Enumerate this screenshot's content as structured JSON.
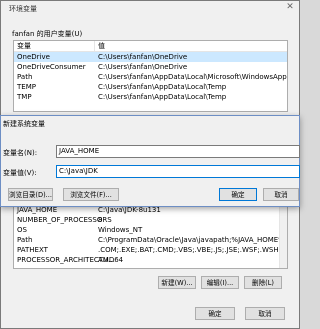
{
  "env_window": {
    "title": "环境变量",
    "close_glyph": "✕",
    "user_vars_label": "fanfan 的用户变量(U)",
    "user_table": {
      "col_var": "变量",
      "col_val": "值",
      "rows": [
        {
          "name": "OneDrive",
          "value": "C:\\Users\\fanfan\\OneDrive"
        },
        {
          "name": "OneDriveConsumer",
          "value": "C:\\Users\\fanfan\\OneDrive"
        },
        {
          "name": "Path",
          "value": "C:\\Users\\fanfan\\AppData\\Local\\Microsoft\\WindowsApps;"
        },
        {
          "name": "TEMP",
          "value": "C:\\Users\\fanfan\\AppData\\Local\\Temp"
        },
        {
          "name": "TMP",
          "value": "C:\\Users\\fanfan\\AppData\\Local\\Temp"
        }
      ]
    },
    "sys_table": {
      "rows": [
        {
          "name": "JAVA_HOME",
          "value": "C:\\Java\\JDK-8u131"
        },
        {
          "name": "NUMBER_OF_PROCESSORS",
          "value": "8"
        },
        {
          "name": "OS",
          "value": "Windows_NT"
        },
        {
          "name": "Path",
          "value": "C:\\ProgramData\\Oracle\\Java\\javapath;%JAVA_HOME%\\bin;..."
        },
        {
          "name": "PATHEXT",
          "value": ".COM;.EXE;.BAT;.CMD;.VBS;.VBE;.JS;.JSE;.WSF;.WSH;.MSC"
        },
        {
          "name": "PROCESSOR_ARCHITECTU...",
          "value": "AMD64"
        }
      ]
    },
    "sys_buttons": {
      "new": "新建(W)...",
      "edit": "编辑(I)...",
      "delete": "删除(L)"
    },
    "bottom_buttons": {
      "ok": "确定",
      "cancel": "取消"
    }
  },
  "new_var_dialog": {
    "title": "新建系统变量",
    "name_label": "变量名(N):",
    "name_value": "JAVA_HOME",
    "value_label": "变量值(V):",
    "value_value": "C:\\Java\\JDK",
    "browse_dir": "浏览目录(D)...",
    "browse_file": "浏览文件(F)...",
    "ok": "确定",
    "cancel": "取消"
  }
}
